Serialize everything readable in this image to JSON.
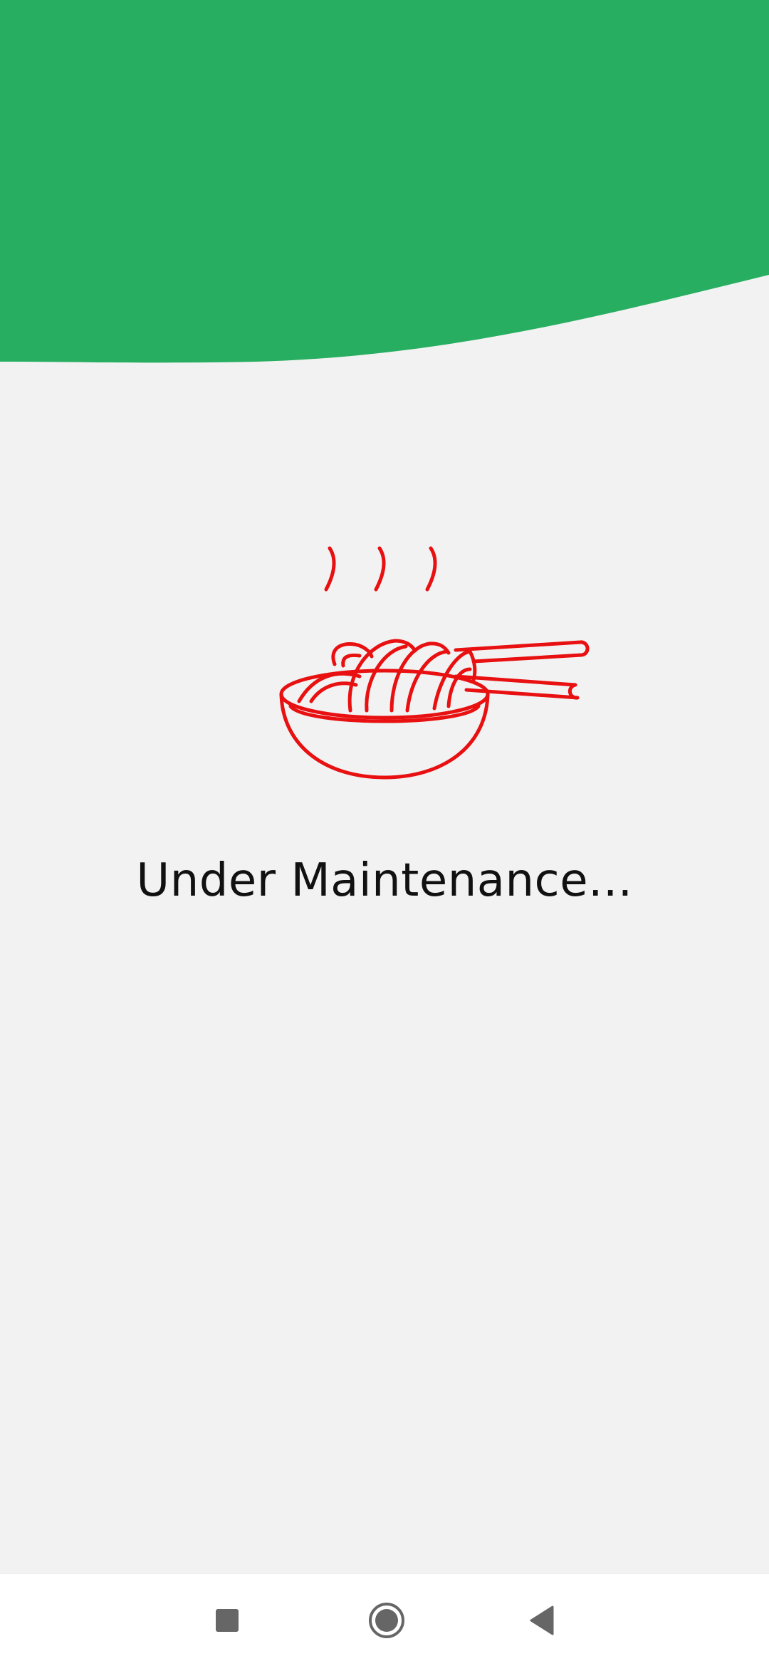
{
  "colors": {
    "header": "#27ae60",
    "background": "#f2f2f2",
    "illustration": "#e81010",
    "nav_icon": "#666666"
  },
  "main": {
    "illustration_icon": "noodle-bowl-icon",
    "message": "Under Maintenance..."
  },
  "nav_bar": {
    "buttons": [
      {
        "icon": "recents-square-icon"
      },
      {
        "icon": "home-circle-icon"
      },
      {
        "icon": "back-triangle-icon"
      }
    ]
  }
}
